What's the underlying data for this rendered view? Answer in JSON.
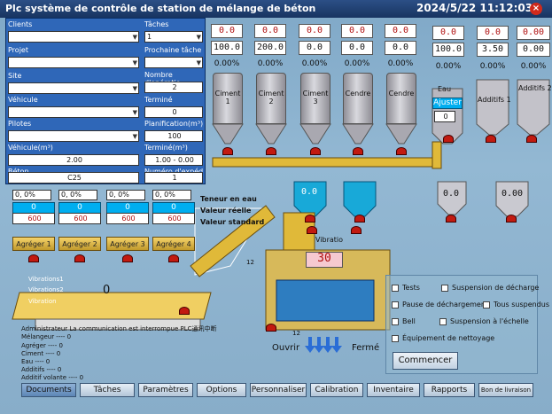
{
  "titlebar": {
    "title": "Plc système de contrôle de station de mélange de béton",
    "datetime": "2024/5/22 11:12:03",
    "close": "×"
  },
  "form": {
    "clients_label": "Clients",
    "taches_label": "Tâches",
    "taches_value": "1",
    "projet_label": "Projet",
    "prochaine_label": "Prochaine tâche",
    "site_label": "Site",
    "nombre_label": "Nombre d'opératio",
    "nombre_value": "2",
    "vehicule_label": "Véhicule",
    "termine_label": "Terminé",
    "termine_value": "0",
    "pilotes_label": "Pilotes",
    "planif_label": "Planification(m³)",
    "planif_value": "100",
    "vehicule_m3_label": "Véhicule(m³)",
    "vehicule_m3_value": "2.00",
    "termine_m3_label": "Terminé(m³)",
    "termine_m3_value": "1.00 - 0.00",
    "beton_label": "Béton",
    "beton_value": "C25",
    "numero_label": "Numéro d'expéd",
    "numero_value": "1"
  },
  "top_values": [
    {
      "val": "0.0",
      "pct": ""
    },
    {
      "val": "0.0",
      "pct": ""
    },
    {
      "val": "0.0",
      "pct": "0.00%"
    },
    {
      "val": "0.0",
      "pct": "0.00%"
    },
    {
      "val": "0.0",
      "pct": "0.00%"
    },
    {
      "val": "0.0",
      "pct": ""
    },
    {
      "val": "0.0",
      "pct": ""
    },
    {
      "val": "0.00",
      "pct": ""
    }
  ],
  "standard_values": [
    {
      "val": "100.0"
    },
    {
      "val": "200.0"
    },
    {
      "val": "0.0"
    },
    {
      "val": "0.0"
    },
    {
      "val": "0.0"
    },
    {
      "val": "0.0"
    },
    {
      "val": "100.0"
    },
    {
      "val": "3.50"
    },
    {
      "val": "0.00"
    }
  ],
  "pcts": {
    "p1": "0.00%",
    "p2": "0.00%",
    "p3": "0.00%",
    "p4": "0.00%",
    "p5": "0.00%",
    "p6": "0.00%",
    "p7": "0.00%",
    "p8": "0.00%",
    "p9": "0.00%"
  },
  "silos": [
    "Ciment 1",
    "Ciment 2",
    "Ciment 3",
    "Cendre",
    "Cendre"
  ],
  "additives": {
    "eau": "Eau",
    "ajuster": "Ajuster",
    "ajuster_value": "0",
    "add1": "Additifs 1",
    "add2": "Additifs 2"
  },
  "scale_values": {
    "s1": "0.0",
    "s2": "0.0",
    "eau": "0.0",
    "add": "0.00"
  },
  "aggregates": [
    {
      "dd": "0, 0%",
      "cyan": "0",
      "std": "600",
      "label": "Agréger 1"
    },
    {
      "dd": "0, 0%",
      "cyan": "0",
      "std": "600",
      "label": "Agréger 2"
    },
    {
      "dd": "0, 0%",
      "cyan": "0",
      "std": "600",
      "label": "Agréger 3"
    },
    {
      "dd": "0, 0%",
      "cyan": "0",
      "std": "600",
      "label": "Agréger 4"
    }
  ],
  "legend": {
    "teneur": "Teneur en eau",
    "reelle": "Valeur réelle",
    "standard": "Valeur standard"
  },
  "belt": {
    "vib1": "Vibrations1",
    "vib2": "Vibrations2",
    "vib": "Vibration",
    "count": "0"
  },
  "mixer": {
    "vibratio": "Vibratio",
    "timer": "30",
    "n12a": "12",
    "n12b": "12",
    "ouvrir": "Ouvrir",
    "ferme": "Fermé"
  },
  "status": [
    "Administrateur La communication est interrompue PLC通讯中断",
    "Mélangeur ---- 0",
    "Agréger ---- 0",
    "Ciment ---- 0",
    "Eau ---- 0",
    "Additifs ---- 0",
    "Additif volante ---- 0"
  ],
  "options": [
    {
      "label": "Tests"
    },
    {
      "label": "Suspension de décharge"
    },
    {
      "label": "Pause de déchargement"
    },
    {
      "label": "Tous suspendus"
    },
    {
      "label": "Bell"
    },
    {
      "label": "Suspension à l'échelle"
    },
    {
      "label": "Équipement de nettoyage"
    }
  ],
  "commencer": "Commencer",
  "tabs": [
    "Documents",
    "Tâches",
    "Paramètres",
    "Options",
    "Personnaliser",
    "Calibration",
    "Inventaire",
    "Rapports",
    "Bon de livraison"
  ],
  "colors": {
    "form_bg": "#2f67b8",
    "cyan": "#00aef0",
    "gold": "#d9b44a",
    "red": "#c21a10"
  }
}
